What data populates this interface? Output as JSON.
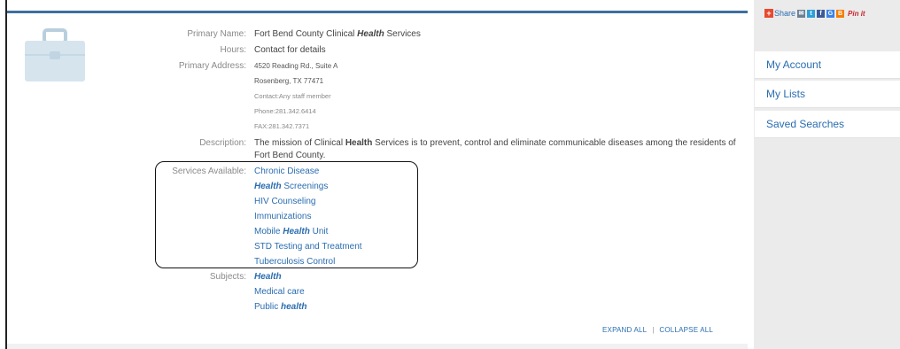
{
  "record": {
    "primary_name_label": "Primary Name:",
    "primary_name_prefix": "Fort Bend County Clinical ",
    "primary_name_highlight": "Health",
    "primary_name_suffix": " Services",
    "hours_label": "Hours:",
    "hours_value": "Contact for details",
    "address_label": "Primary Address:",
    "address_line1": "4520 Reading Rd., Suite A",
    "address_line2": "Rosenberg, TX 77471",
    "contact_line": "Contact:Any staff member",
    "phone_line": "Phone:281.342.6414",
    "fax_line": "FAX:281.342.7371",
    "description_label": "Description:",
    "description_prefix": "The mission of Clinical ",
    "description_highlight": "Health",
    "description_suffix": " Services is to prevent, control and eliminate communicable diseases among the residents of Fort Bend County.",
    "services_label": "Services Available:",
    "services": [
      {
        "prefix": "Chronic Disease",
        "highlight": "",
        "suffix": ""
      },
      {
        "prefix": "",
        "highlight": "Health",
        "suffix": " Screenings"
      },
      {
        "prefix": "HIV Counseling",
        "highlight": "",
        "suffix": ""
      },
      {
        "prefix": "Immunizations",
        "highlight": "",
        "suffix": ""
      },
      {
        "prefix": "Mobile ",
        "highlight": "Health",
        "suffix": " Unit"
      },
      {
        "prefix": "STD Testing and Treatment",
        "highlight": "",
        "suffix": ""
      },
      {
        "prefix": "Tuberculosis Control",
        "highlight": "",
        "suffix": ""
      }
    ],
    "subjects_label": "Subjects:",
    "subjects": [
      {
        "prefix": "",
        "highlight": "Health",
        "suffix": ""
      },
      {
        "prefix": "Medical care",
        "highlight": "",
        "suffix": ""
      },
      {
        "prefix": "Public ",
        "highlight": "health",
        "suffix": ""
      }
    ]
  },
  "actions": {
    "expand_all": "EXPAND ALL",
    "separator": "|",
    "collapse_all": "COLLAPSE ALL"
  },
  "sidebar": {
    "share_label": "Share",
    "share_icons": [
      {
        "name": "email-icon",
        "color": "#6b7f95",
        "glyph": "✉"
      },
      {
        "name": "twitter-icon",
        "color": "#2f9fd9",
        "glyph": "t"
      },
      {
        "name": "facebook-icon",
        "color": "#3b5998",
        "glyph": "f"
      },
      {
        "name": "google-icon",
        "color": "#3b83e8",
        "glyph": "G"
      },
      {
        "name": "blogger-icon",
        "color": "#f57d00",
        "glyph": "B"
      }
    ],
    "pinit_label": "Pin it",
    "links": [
      "My Account",
      "My Lists",
      "Saved Searches"
    ]
  },
  "colors": {
    "link": "#2a6db0",
    "accent_bar": "#3d6f9e",
    "sidebar_bg": "#ebebeb",
    "highlight_border": "#111111"
  },
  "icons": {
    "record_icon": "briefcase-icon"
  }
}
